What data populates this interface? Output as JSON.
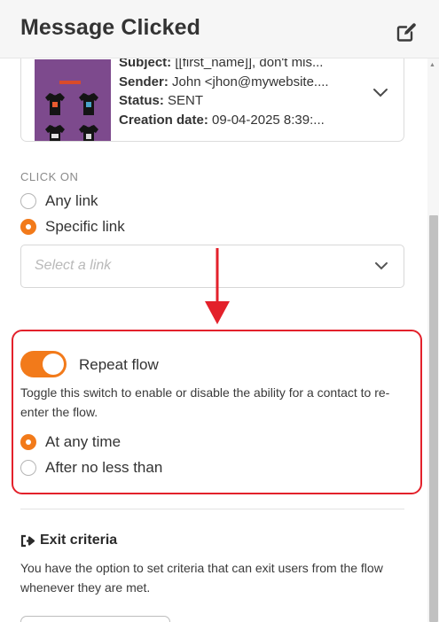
{
  "header": {
    "title": "Message Clicked",
    "edit_icon": "edit-icon"
  },
  "email_card": {
    "subject_label": "Subject:",
    "subject_value": " [[first_name]], don't mis...",
    "sender_label": "Sender:",
    "sender_value": " John <jhon@mywebsite....",
    "status_label": "Status:",
    "status_value": " SENT",
    "date_label": "Creation date:",
    "date_value": " 09-04-2025 8:39:..."
  },
  "click_on": {
    "label": "CLICK ON",
    "options": [
      {
        "label": "Any link",
        "selected": false
      },
      {
        "label": "Specific link",
        "selected": true
      }
    ],
    "link_select_placeholder": "Select a link"
  },
  "annotation": {
    "arrow_color": "#e3212b",
    "highlight_color": "#e3212b"
  },
  "repeat_flow": {
    "toggle_on": true,
    "label": "Repeat flow",
    "help_text": "Toggle this switch to enable or disable the ability for a contact to re-enter the flow.",
    "options": [
      {
        "label": "At any time",
        "selected": true
      },
      {
        "label": "After no less than",
        "selected": false
      }
    ]
  },
  "exit_criteria": {
    "title": "Exit criteria",
    "icon": "exit-icon",
    "description": "You have the option to set criteria that can exit users from the flow whenever they are met."
  },
  "colors": {
    "accent": "#f27a1a",
    "text": "#333333",
    "muted": "#8a8a8a"
  }
}
